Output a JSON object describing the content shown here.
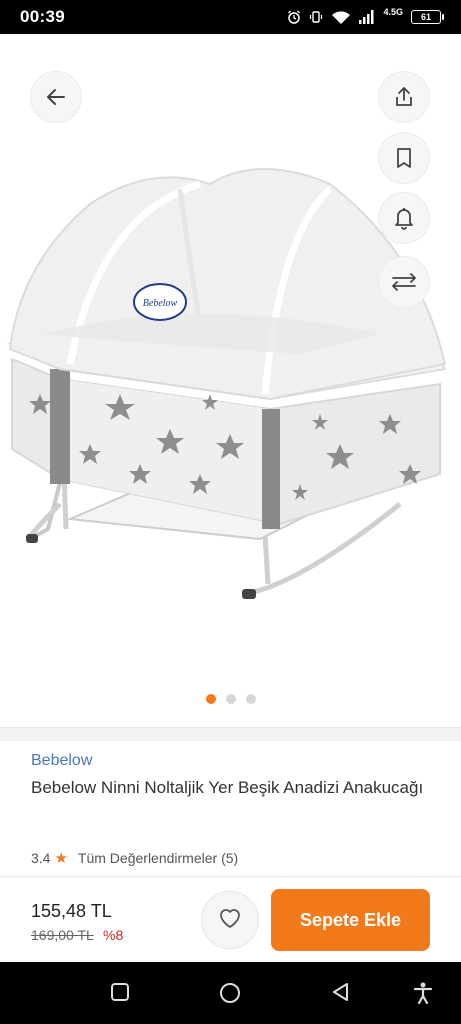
{
  "status_bar": {
    "time": "00:39",
    "network": "4.5G",
    "battery": "61"
  },
  "gallery": {
    "image_count": 3,
    "active_index": 0,
    "buttons": [
      "back-icon",
      "share-icon",
      "bookmark-icon",
      "bell-icon",
      "compare-arrows-icon"
    ],
    "image_logo_text": "Bebelow"
  },
  "product": {
    "brand": "Bebelow",
    "title": "Bebelow Ninni Noltaljik Yer Beşik Anadizi Anakucağı",
    "rating": "3.4",
    "reviews_link": "Tüm Değerlendirmeler (5)"
  },
  "purchase": {
    "price": "155,48 TL",
    "old_price": "169,00 TL",
    "discount": "%8",
    "add_to_cart": "Sepete Ekle"
  },
  "colors": {
    "accent": "#f27a1a",
    "brand_link": "#4a73c4",
    "discount": "#d21f26"
  },
  "nav_bar": {
    "buttons": [
      "recents-icon",
      "home-icon",
      "back-triangle-icon",
      "accessibility-icon"
    ]
  }
}
